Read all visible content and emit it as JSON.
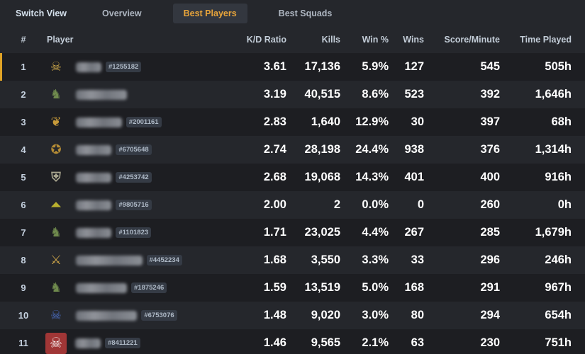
{
  "tabs": {
    "switch_view": "Switch View",
    "overview": "Overview",
    "best_players": "Best Players",
    "best_squads": "Best Squads",
    "active": "best_players"
  },
  "colors": {
    "accent": "#e9a53a",
    "highlight_border": "#e0a326",
    "row_dark": "#1d1e22",
    "row_light": "#25272c",
    "tag_bg": "#353b45"
  },
  "columns": {
    "rank": "#",
    "player": "Player",
    "kd": "K/D Ratio",
    "kills": "Kills",
    "win_pct": "Win %",
    "wins": "Wins",
    "spm": "Score/Minute",
    "time": "Time Played"
  },
  "rows": [
    {
      "rank": "1",
      "emblem": "skull-crossed-axes-icon",
      "emblem_glyph": "☠",
      "name": "█████",
      "tag": "#1255182",
      "kd": "3.61",
      "kills": "17,136",
      "win_pct": "5.9%",
      "wins": "127",
      "spm": "545",
      "time": "505h"
    },
    {
      "rank": "2",
      "emblem": "green-helmet-emblem-icon",
      "emblem_glyph": "♞",
      "name": "██████████",
      "tag": "",
      "kd": "3.19",
      "kills": "40,515",
      "win_pct": "8.6%",
      "wins": "523",
      "spm": "392",
      "time": "1,646h"
    },
    {
      "rank": "3",
      "emblem": "laurel-skull-emblem-icon",
      "emblem_glyph": "❦",
      "name": "█████████",
      "tag": "#2001161",
      "kd": "2.83",
      "kills": "1,640",
      "win_pct": "12.9%",
      "wins": "30",
      "spm": "397",
      "time": "68h"
    },
    {
      "rank": "4",
      "emblem": "gold-beast-emblem-icon",
      "emblem_glyph": "✪",
      "name": "███████",
      "tag": "#6705648",
      "kd": "2.74",
      "kills": "28,198",
      "win_pct": "24.4%",
      "wins": "938",
      "spm": "376",
      "time": "1,314h"
    },
    {
      "rank": "5",
      "emblem": "armored-helmet-emblem-icon",
      "emblem_glyph": "⛨",
      "name": "███████",
      "tag": "#4253742",
      "kd": "2.68",
      "kills": "19,068",
      "win_pct": "14.3%",
      "wins": "401",
      "spm": "400",
      "time": "916h"
    },
    {
      "rank": "6",
      "emblem": "sergeant-chevron-icon",
      "emblem_glyph": "⏶",
      "name": "███████",
      "tag": "#9805716",
      "kd": "2.00",
      "kills": "2",
      "win_pct": "0.0%",
      "wins": "0",
      "spm": "260",
      "time": "0h"
    },
    {
      "rank": "7",
      "emblem": "green-helmet-emblem-icon",
      "emblem_glyph": "♞",
      "name": "███████",
      "tag": "#1101823",
      "kd": "1.71",
      "kills": "23,025",
      "win_pct": "4.4%",
      "wins": "267",
      "spm": "285",
      "time": "1,679h"
    },
    {
      "rank": "8",
      "emblem": "crossed-swords-skull-icon",
      "emblem_glyph": "⚔",
      "name": "█████████████",
      "tag": "#4452234",
      "kd": "1.68",
      "kills": "3,550",
      "win_pct": "3.3%",
      "wins": "33",
      "spm": "296",
      "time": "246h"
    },
    {
      "rank": "9",
      "emblem": "green-helmet-emblem-icon",
      "emblem_glyph": "♞",
      "name": "██████████",
      "tag": "#1875246",
      "kd": "1.59",
      "kills": "13,519",
      "win_pct": "5.0%",
      "wins": "168",
      "spm": "291",
      "time": "967h"
    },
    {
      "rank": "10",
      "emblem": "blue-cobra-skull-icon",
      "emblem_glyph": "☠",
      "name": "████████████",
      "tag": "#6753076",
      "kd": "1.48",
      "kills": "9,020",
      "win_pct": "3.0%",
      "wins": "80",
      "spm": "294",
      "time": "654h"
    },
    {
      "rank": "11",
      "emblem": "red-skull-icon",
      "emblem_glyph": "☠",
      "name": "█████",
      "tag": "#8411221",
      "kd": "1.46",
      "kills": "9,565",
      "win_pct": "2.1%",
      "wins": "63",
      "spm": "230",
      "time": "751h"
    }
  ]
}
